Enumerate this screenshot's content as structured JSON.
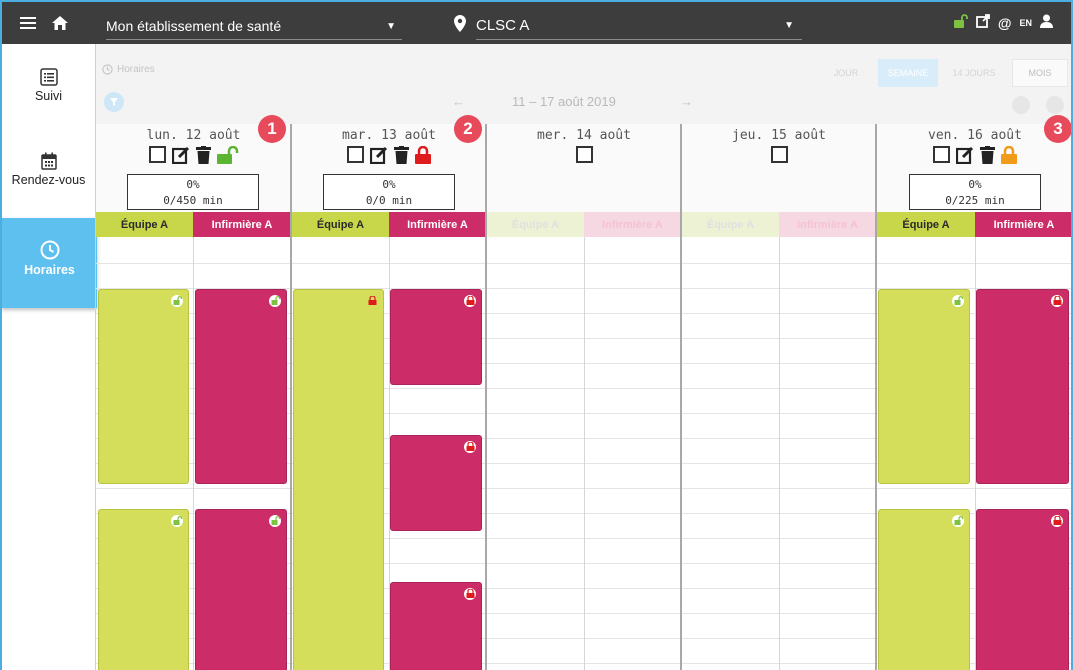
{
  "topbar": {
    "establishment": "Mon établissement de santé",
    "site": "CLSC A",
    "lang": "EN",
    "icons": [
      "menu-icon",
      "home-icon",
      "location-pin-icon",
      "unlock-icon",
      "external-link-icon",
      "at-icon",
      "user-icon"
    ]
  },
  "sidebar": {
    "items": [
      {
        "label": "Suivi",
        "icon": "list-icon"
      },
      {
        "label": "Rendez-vous",
        "icon": "calendar-icon"
      },
      {
        "label": "Horaires",
        "icon": "clock-icon",
        "active": true
      }
    ]
  },
  "toolbar": {
    "crumb": "Horaires",
    "week_label": "11 – 17 août 2019",
    "prev": "←",
    "next": "→",
    "views": [
      "JOUR",
      "SEMAINE",
      "14 JOURS",
      "MOIS"
    ],
    "active_view": "SEMAINE"
  },
  "days": [
    {
      "name": "lun. 12 août",
      "percent": "0%",
      "minutes": "0/450 min",
      "lock_status": "unlocked",
      "lock_color": "#5cb531"
    },
    {
      "name": "mar. 13 août",
      "percent": "0%",
      "minutes": "0/0 min",
      "lock_status": "locked",
      "lock_color": "#e01b1b"
    },
    {
      "name": "mer. 14 août"
    },
    {
      "name": "jeu. 15 août"
    },
    {
      "name": "ven. 16 août",
      "percent": "0%",
      "minutes": "0/225 min",
      "lock_status": "locked",
      "lock_color": "#f29a1a"
    }
  ],
  "resources": {
    "equipe": "Équipe A",
    "infirmiere": "Infirmière A"
  },
  "badges": [
    "1",
    "2",
    "3"
  ],
  "colors": {
    "equipe": "#d4de5a",
    "infirmiere": "#cc2d68",
    "active_nav": "#5ec0ef",
    "badge": "#e74a5a",
    "topbar": "#3d3d3d"
  }
}
